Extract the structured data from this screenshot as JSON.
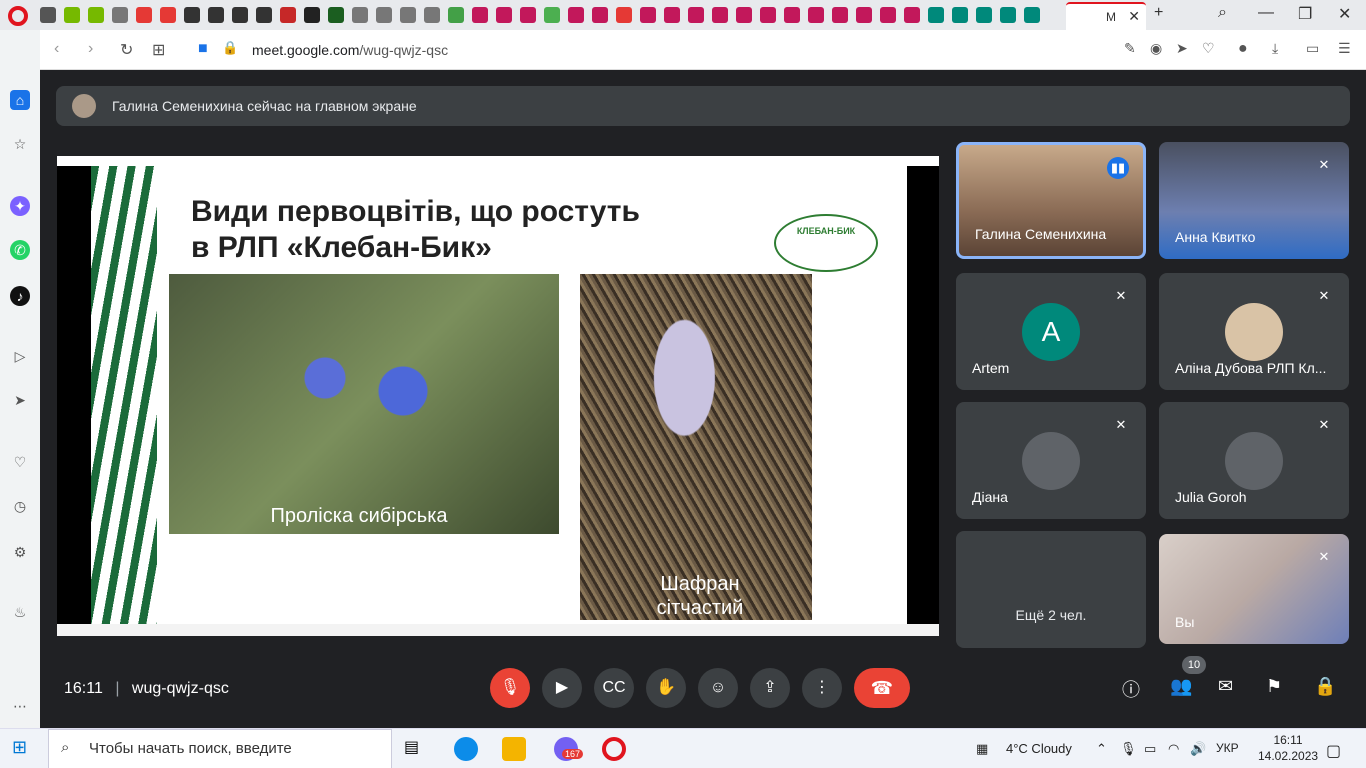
{
  "browser": {
    "active_tab_label": "M",
    "url_host": "meet.google.com",
    "url_path": "/wug-qwjz-qsc"
  },
  "banner": {
    "text": "Галина Семенихина сейчас на главном экране"
  },
  "slide": {
    "title_line1": "Види первоцвітів, що ростуть",
    "title_line2": "в РЛП «Клебан-Бик»",
    "logo_text": "КЛЕБАН-БИК",
    "caption1": "Проліска сибірська",
    "caption2_line1": "Шафран",
    "caption2_line2": "сітчастий"
  },
  "participants": [
    {
      "name": "Галина Семенихина",
      "speaking": true
    },
    {
      "name": "Анна Квитко",
      "muted": true
    },
    {
      "name": "Artem",
      "initial": "A",
      "avatar_color": "#00897b",
      "muted": true
    },
    {
      "name": "Аліна Дубова РЛП Кл...",
      "muted": true
    },
    {
      "name": "Діана",
      "muted": true
    },
    {
      "name": "Julia Goroh",
      "muted": true
    },
    {
      "name": "Ещё 2 чел."
    },
    {
      "name": "Вы",
      "muted": true
    }
  ],
  "controls": {
    "time": "16:11",
    "meeting_code": "wug-qwjz-qsc",
    "people_count": "10"
  },
  "taskbar": {
    "search_placeholder": "Чтобы начать поиск, введите",
    "weather": "4°C  Cloudy",
    "lang": "УКР",
    "time": "16:11",
    "date": "14.02.2023",
    "notification_count": "167"
  },
  "colors": {
    "accent": "#8ab4f8",
    "danger": "#ea4335",
    "meet_bg": "#202124",
    "opera_red": "#e0141e"
  }
}
